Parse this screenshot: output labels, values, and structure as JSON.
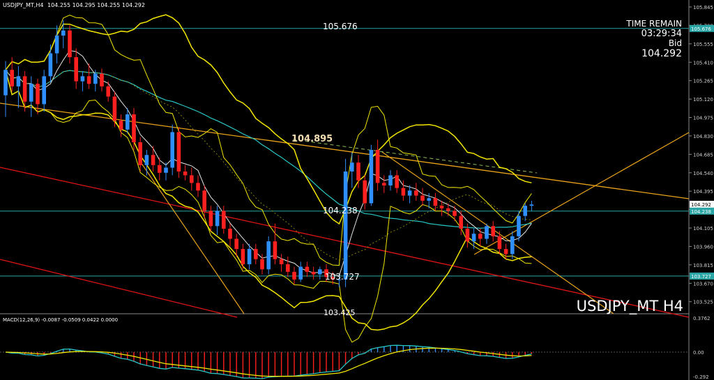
{
  "header": {
    "symbol_info": "USDJPY_MT,H4",
    "ohlc": "104.255 104.295 104.255 104.292"
  },
  "info_panel": {
    "time_remain_label": "TIME REMAIN",
    "time_remain_value": "03:29:34",
    "bid_label": "Bid",
    "bid_value": "104.292"
  },
  "watermark": "USDJPY_MT H4",
  "levels": {
    "resistance": "105.676",
    "trendline_value": "104.895",
    "mid": "104.238",
    "support": "103.727",
    "lower": "103.425"
  },
  "price_axis": {
    "ticks": [
      "105.845",
      "105.700",
      "105.555",
      "105.410",
      "105.265",
      "105.120",
      "104.975",
      "104.830",
      "104.685",
      "104.540",
      "104.395",
      "104.250",
      "104.105",
      "103.960",
      "103.815",
      "103.670",
      "103.525"
    ],
    "current_price": "104.292",
    "mid_tag": "104.238",
    "resistance_tag": "105.676",
    "support_tag": "103.727"
  },
  "macd": {
    "label": "MACD(12,26,9) -0.0087 -0.0509 0.0422 0.0000",
    "ticks": [
      "0.3762",
      "0.00",
      "-0.292"
    ]
  },
  "colors": {
    "bull": "#2f8fff",
    "bear": "#ff2020",
    "bands": "#f2e600",
    "ma_cyan": "#28c6c6",
    "level_line": "#2aa6a6",
    "trend_orange": "#e8a21a",
    "trend_red": "#e01414"
  },
  "chart_data": {
    "type": "candlestick",
    "symbol": "USDJPY_MT",
    "timeframe": "H4",
    "ylim": [
      103.43,
      105.9
    ],
    "horizontal_levels": [
      105.676,
      104.238,
      103.727
    ],
    "candles": [
      [
        105.15,
        105.42,
        104.98,
        105.35
      ],
      [
        105.35,
        105.45,
        105.18,
        105.22
      ],
      [
        105.22,
        105.38,
        105.05,
        105.3
      ],
      [
        105.3,
        105.34,
        105.02,
        105.1
      ],
      [
        105.1,
        105.3,
        104.98,
        105.24
      ],
      [
        105.24,
        105.28,
        105.0,
        105.08
      ],
      [
        105.08,
        105.35,
        105.02,
        105.3
      ],
      [
        105.3,
        105.55,
        105.25,
        105.48
      ],
      [
        105.48,
        105.7,
        105.4,
        105.62
      ],
      [
        105.62,
        105.74,
        105.52,
        105.66
      ],
      [
        105.66,
        105.7,
        105.4,
        105.45
      ],
      [
        105.45,
        105.52,
        105.2,
        105.26
      ],
      [
        105.26,
        105.34,
        105.18,
        105.3
      ],
      [
        105.3,
        105.4,
        105.2,
        105.24
      ],
      [
        105.24,
        105.35,
        105.18,
        105.32
      ],
      [
        105.32,
        105.36,
        105.18,
        105.22
      ],
      [
        105.22,
        105.26,
        105.1,
        105.14
      ],
      [
        105.14,
        105.18,
        104.9,
        104.95
      ],
      [
        104.95,
        105.0,
        104.82,
        104.88
      ],
      [
        104.88,
        105.05,
        104.85,
        105.0
      ],
      [
        105.0,
        105.05,
        104.72,
        104.78
      ],
      [
        104.78,
        104.82,
        104.55,
        104.6
      ],
      [
        104.6,
        104.72,
        104.52,
        104.68
      ],
      [
        104.68,
        104.75,
        104.55,
        104.6
      ],
      [
        104.6,
        104.66,
        104.48,
        104.54
      ],
      [
        104.54,
        104.62,
        104.48,
        104.58
      ],
      [
        104.58,
        104.92,
        104.52,
        104.86
      ],
      [
        104.86,
        104.9,
        104.5,
        104.55
      ],
      [
        104.55,
        104.6,
        104.48,
        104.52
      ],
      [
        104.52,
        104.58,
        104.4,
        104.46
      ],
      [
        104.46,
        104.52,
        104.35,
        104.4
      ],
      [
        104.4,
        104.44,
        104.18,
        104.24
      ],
      [
        104.24,
        104.28,
        104.08,
        104.12
      ],
      [
        104.12,
        104.28,
        104.05,
        104.24
      ],
      [
        104.24,
        104.28,
        104.06,
        104.1
      ],
      [
        104.1,
        104.14,
        103.96,
        104.02
      ],
      [
        104.02,
        104.06,
        103.88,
        103.94
      ],
      [
        103.94,
        103.98,
        103.78,
        103.82
      ],
      [
        103.82,
        103.98,
        103.78,
        103.94
      ],
      [
        103.94,
        103.98,
        103.82,
        103.86
      ],
      [
        103.86,
        103.9,
        103.74,
        103.78
      ],
      [
        103.78,
        104.04,
        103.74,
        104.0
      ],
      [
        104.0,
        104.14,
        103.82,
        103.86
      ],
      [
        103.86,
        103.9,
        103.76,
        103.82
      ],
      [
        103.82,
        103.88,
        103.72,
        103.76
      ],
      [
        103.76,
        103.8,
        103.66,
        103.7
      ],
      [
        103.7,
        103.84,
        103.68,
        103.8
      ],
      [
        103.8,
        103.84,
        103.72,
        103.76
      ],
      [
        103.76,
        103.8,
        103.7,
        103.74
      ],
      [
        103.74,
        103.8,
        103.7,
        103.78
      ],
      [
        103.78,
        103.82,
        103.68,
        103.72
      ],
      [
        103.72,
        103.76,
        103.66,
        103.7
      ],
      [
        103.7,
        103.74,
        103.64,
        103.7
      ],
      [
        103.7,
        104.65,
        103.64,
        104.55
      ],
      [
        104.55,
        104.7,
        104.42,
        104.62
      ],
      [
        104.62,
        104.68,
        104.42,
        104.48
      ],
      [
        104.48,
        104.52,
        104.25,
        104.3
      ],
      [
        104.3,
        104.76,
        104.28,
        104.72
      ],
      [
        104.72,
        104.8,
        104.4,
        104.46
      ],
      [
        104.46,
        104.52,
        104.38,
        104.44
      ],
      [
        104.44,
        104.56,
        104.4,
        104.52
      ],
      [
        104.52,
        104.56,
        104.38,
        104.42
      ],
      [
        104.42,
        104.48,
        104.32,
        104.36
      ],
      [
        104.36,
        104.44,
        104.3,
        104.4
      ],
      [
        104.4,
        104.46,
        104.32,
        104.36
      ],
      [
        104.36,
        104.42,
        104.28,
        104.32
      ],
      [
        104.32,
        104.38,
        104.26,
        104.34
      ],
      [
        104.34,
        104.38,
        104.24,
        104.28
      ],
      [
        104.28,
        104.32,
        104.2,
        104.26
      ],
      [
        104.26,
        104.3,
        104.2,
        104.24
      ],
      [
        104.24,
        104.28,
        104.16,
        104.2
      ],
      [
        104.2,
        104.24,
        104.05,
        104.1
      ],
      [
        104.1,
        104.14,
        103.95,
        104.0
      ],
      [
        104.0,
        104.1,
        103.94,
        104.06
      ],
      [
        104.06,
        104.1,
        103.96,
        104.02
      ],
      [
        104.02,
        104.14,
        103.98,
        104.12
      ],
      [
        104.12,
        104.16,
        104.0,
        104.04
      ],
      [
        104.04,
        104.08,
        103.9,
        103.94
      ],
      [
        103.94,
        103.98,
        103.86,
        103.9
      ],
      [
        103.9,
        104.08,
        103.86,
        104.04
      ],
      [
        104.04,
        104.24,
        104.0,
        104.2
      ],
      [
        104.2,
        104.3,
        104.16,
        104.28
      ],
      [
        104.28,
        104.32,
        104.24,
        104.29
      ]
    ]
  }
}
